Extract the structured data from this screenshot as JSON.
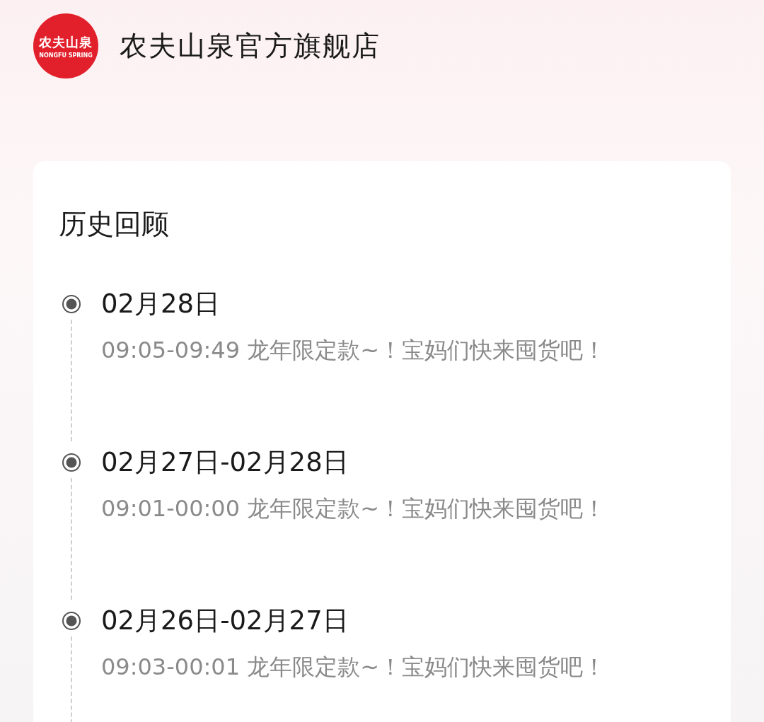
{
  "store": {
    "logo_text": "农夫山泉",
    "logo_subtext": "NONGFU SPRING",
    "name": "农夫山泉官方旗舰店"
  },
  "history": {
    "title": "历史回顾",
    "entries": [
      {
        "date": "02月28日",
        "description": "09:05-09:49 龙年限定款~！宝妈们快来囤货吧！"
      },
      {
        "date": "02月27日-02月28日",
        "description": "09:01-00:00 龙年限定款~！宝妈们快来囤货吧！"
      },
      {
        "date": "02月26日-02月27日",
        "description": "09:03-00:01 龙年限定款~！宝妈们快来囤货吧！"
      }
    ]
  }
}
